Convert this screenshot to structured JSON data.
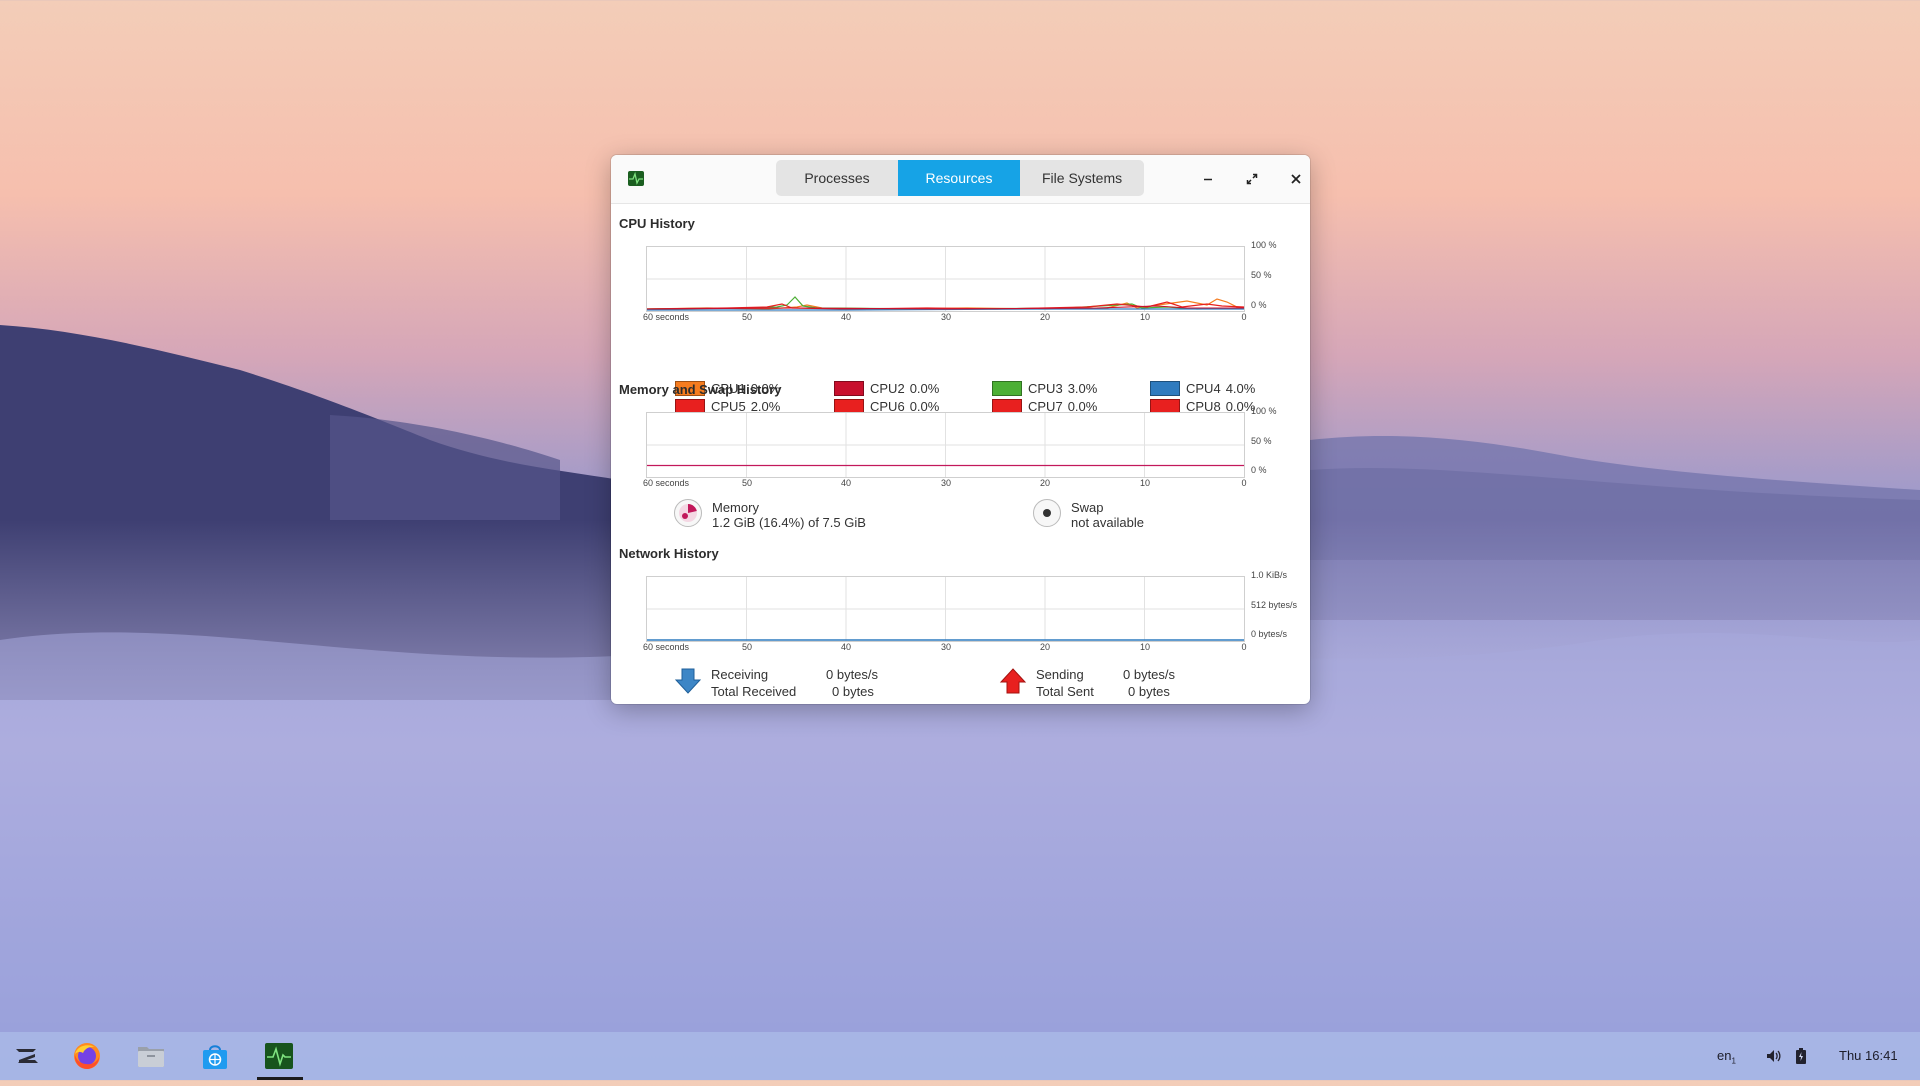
{
  "window": {
    "tabs": [
      "Processes",
      "Resources",
      "File Systems"
    ],
    "active_tab": "Resources",
    "controls": {
      "minimize": "–",
      "maximize": "⤢",
      "close": "✕"
    }
  },
  "cpu": {
    "title": "CPU History",
    "x_labels": [
      "60 seconds",
      "50",
      "40",
      "30",
      "20",
      "10",
      "0"
    ],
    "y_labels": [
      "100 %",
      "50 %",
      "0 %"
    ],
    "items": [
      {
        "name": "CPU1",
        "value": "0.0%",
        "color": "#f57c1f"
      },
      {
        "name": "CPU2",
        "value": "0.0%",
        "color": "#c8102e"
      },
      {
        "name": "CPU3",
        "value": "3.0%",
        "color": "#4caf35"
      },
      {
        "name": "CPU4",
        "value": "4.0%",
        "color": "#2f7bbf"
      },
      {
        "name": "CPU5",
        "value": "2.0%",
        "color": "#e8201f"
      },
      {
        "name": "CPU6",
        "value": "0.0%",
        "color": "#e8201f"
      },
      {
        "name": "CPU7",
        "value": "0.0%",
        "color": "#e8201f"
      },
      {
        "name": "CPU8",
        "value": "0.0%",
        "color": "#e8201f"
      }
    ]
  },
  "memory": {
    "title": "Memory and Swap History",
    "x_labels": [
      "60 seconds",
      "50",
      "40",
      "30",
      "20",
      "10",
      "0"
    ],
    "y_labels": [
      "100 %",
      "50 %",
      "0 %"
    ],
    "memory_label": "Memory",
    "memory_value": "1.2 GiB (16.4%) of 7.5 GiB",
    "memory_fraction": 0.164,
    "memory_color": "#c2185b",
    "swap_label": "Swap",
    "swap_value": "not available"
  },
  "network": {
    "title": "Network History",
    "x_labels": [
      "60 seconds",
      "50",
      "40",
      "30",
      "20",
      "10",
      "0"
    ],
    "y_labels": [
      "1.0 KiB/s",
      "512 bytes/s",
      "0 bytes/s"
    ],
    "receiving_label": "Receiving",
    "receiving_value": "0 bytes/s",
    "total_received_label": "Total Received",
    "total_received_value": "0 bytes",
    "sending_label": "Sending",
    "sending_value": "0 bytes/s",
    "total_sent_label": "Total Sent",
    "total_sent_value": "0 bytes"
  },
  "taskbar": {
    "apps": [
      "zorin-menu-icon",
      "firefox-icon",
      "files-icon",
      "software-store-icon",
      "system-monitor-icon"
    ],
    "keyboard_layout": "en",
    "keyboard_layout_sub": "1",
    "clock": "Thu 16:41"
  }
}
